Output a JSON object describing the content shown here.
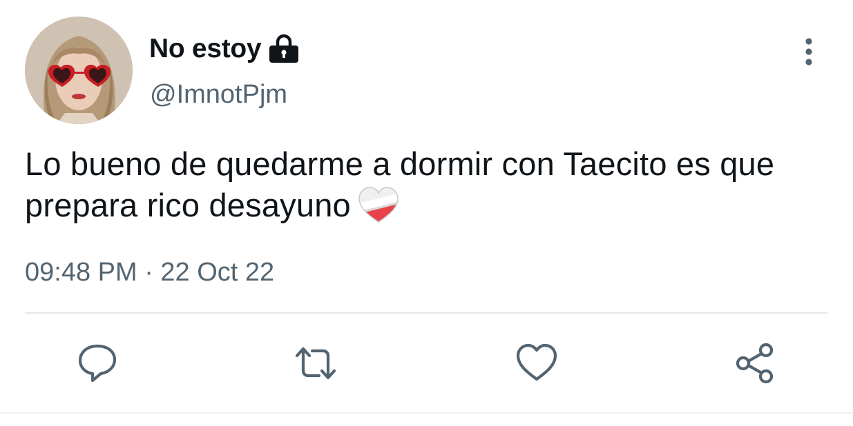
{
  "user": {
    "display_name": "No estoy",
    "handle": "@ImnotPjm",
    "protected_icon": "lock-icon",
    "avatar": "profile-avatar"
  },
  "tweet": {
    "text": "Lo bueno de quedarme a dormir con Taecito es que prepara rico desayuno",
    "emoji": "mending-heart-emoji",
    "timestamp": "09:48 PM · 22 Oct 22"
  },
  "actions": [
    {
      "name": "reply",
      "icon": "comment-icon"
    },
    {
      "name": "retweet",
      "icon": "retweet-icon"
    },
    {
      "name": "like",
      "icon": "heart-icon"
    },
    {
      "name": "share",
      "icon": "share-icon"
    }
  ],
  "menu": {
    "icon": "more-vertical-icon"
  },
  "colors": {
    "text_primary": "#0f1419",
    "text_secondary": "#536471",
    "divider": "#e4e8eb"
  }
}
